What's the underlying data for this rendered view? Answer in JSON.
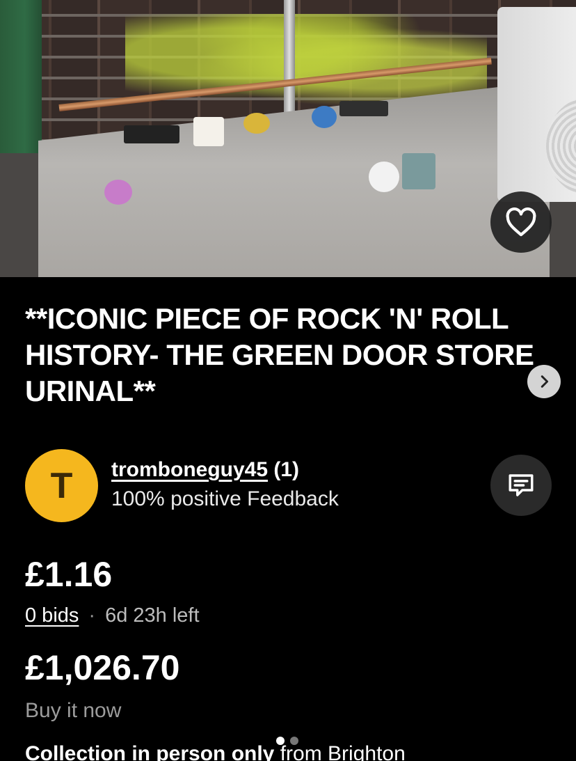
{
  "listing": {
    "title": "**ICONIC PIECE OF ROCK 'N' ROLL HISTORY- THE GREEN DOOR STORE URINAL**",
    "image_alt": "Stainless steel urinal trough with stickers against a brick wall with graffiti",
    "current_price": "£1.16",
    "bids": "0 bids",
    "separator": "·",
    "time_left": "6d 23h left",
    "buy_it_now_price": "£1,026.70",
    "buy_it_now_label": "Buy it now",
    "collection_bold": "Collection in person only",
    "collection_rest": " from Brighton"
  },
  "seller": {
    "initial": "T",
    "username": "tromboneguy45",
    "rating_count": "(1)",
    "feedback": "100% positive Feedback"
  },
  "icons": {
    "favorite": "heart-icon",
    "next": "chevron-right-icon",
    "message": "message-icon"
  },
  "colors": {
    "background": "#000000",
    "avatar": "#f5b71e",
    "muted_text": "#9c9c9c"
  },
  "carousel": {
    "pages": 2,
    "active": 1
  }
}
